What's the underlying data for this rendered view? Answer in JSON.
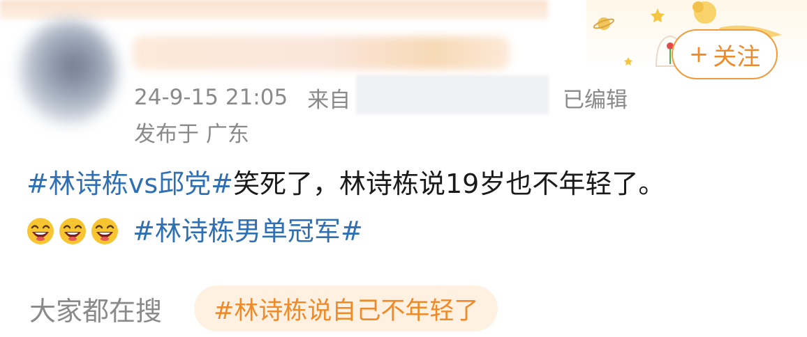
{
  "header": {
    "timestamp": "24-9-15 21:05",
    "source_prefix": "来自",
    "edited_label": "已编辑",
    "location": "发布于 广东"
  },
  "follow_button": {
    "plus": "+",
    "label": "关注",
    "color": "#ef8a2a"
  },
  "post": {
    "topic1": "#林诗栋vs邱党#",
    "text": "笑死了，林诗栋说19岁也不年轻了。",
    "emojis": [
      "laughing-face",
      "laughing-face",
      "laughing-face"
    ],
    "topic2": "#林诗栋男单冠军#",
    "topic_color": "#2f6fb3"
  },
  "search": {
    "label": "大家都在搜",
    "chip": "#林诗栋说自己不年轻了",
    "chip_bg": "#fff1e2"
  }
}
